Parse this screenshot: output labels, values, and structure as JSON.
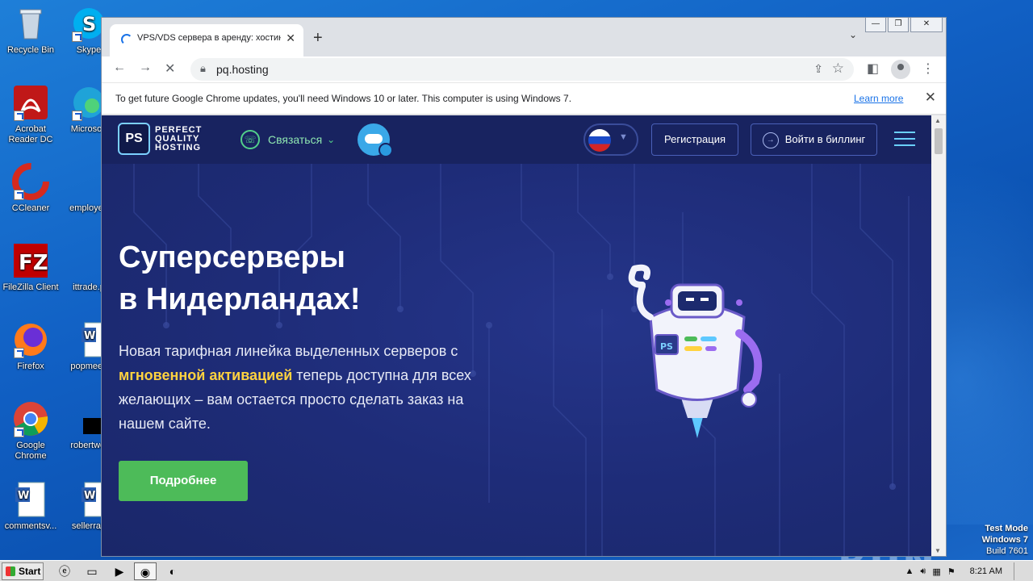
{
  "desktop": {
    "icons_col1": [
      {
        "label": "Recycle Bin",
        "icon": "recycle-bin-icon"
      },
      {
        "label": "Acrobat Reader DC",
        "icon": "acrobat-icon"
      },
      {
        "label": "CCleaner",
        "icon": "ccleaner-icon"
      },
      {
        "label": "FileZilla Client",
        "icon": "filezilla-icon"
      },
      {
        "label": "Firefox",
        "icon": "firefox-icon"
      },
      {
        "label": "Google Chrome",
        "icon": "chrome-icon"
      },
      {
        "label": "commentsv...",
        "icon": "word-doc-icon"
      }
    ],
    "icons_col2": [
      {
        "label": "Skype",
        "icon": "skype-icon"
      },
      {
        "label": "Microsoft",
        "icon": "edge-icon"
      },
      {
        "label": "employee",
        "icon": "file-icon"
      },
      {
        "label": "ittrade.p",
        "icon": "file-icon"
      },
      {
        "label": "popmeeti",
        "icon": "word-doc-icon"
      },
      {
        "label": "robertwel",
        "icon": "file-icon"
      },
      {
        "label": "sellerrap",
        "icon": "word-doc-icon"
      }
    ],
    "watermark": "ANY RUN",
    "test_mode": {
      "line1": "Test Mode",
      "line2": "Windows 7",
      "line3": "Build 7601"
    }
  },
  "browser": {
    "tab_title": "VPS/VDS сервера в аренду: хостинг",
    "url": "pq.hosting",
    "infobar": {
      "message": "To get future Google Chrome updates, you'll need Windows 10 or later. This computer is using Windows 7.",
      "link": "Learn more"
    }
  },
  "site": {
    "logo_mark": "PS",
    "logo_lines": [
      "PERFECT",
      "QUALITY",
      "HOSTING"
    ],
    "contact_label": "Связаться",
    "register_label": "Регистрация",
    "login_label": "Войти в биллинг",
    "hero_title_1": "Суперсерверы",
    "hero_title_2": "в Нидерландах!",
    "hero_text_1": "Новая тарифная линейка выделенных серверов с",
    "hero_highlight": "мгновенной активацией",
    "hero_text_2": "теперь доступна для всех желающих – вам остается просто сделать заказ на нашем сайте.",
    "cta_label": "Подробнее",
    "accent": "#4dbb59",
    "highlight_color": "#ffd23f"
  },
  "taskbar": {
    "start_label": "Start",
    "clock": "8:21 AM"
  }
}
